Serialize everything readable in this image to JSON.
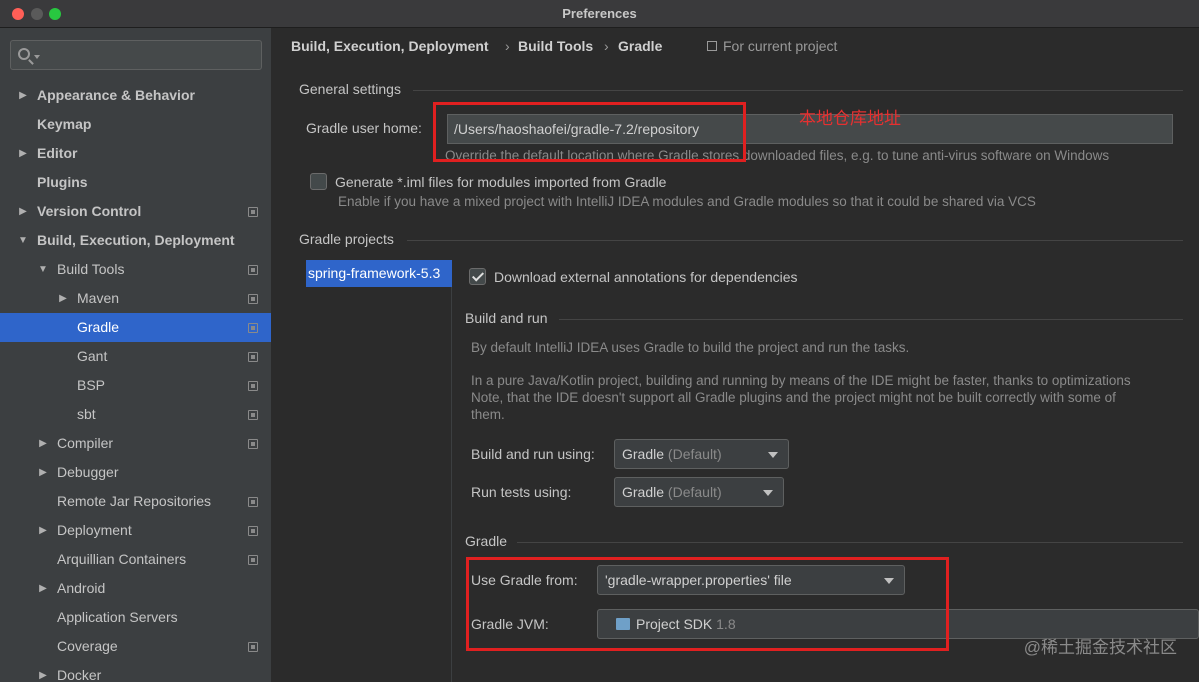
{
  "window": {
    "title": "Preferences"
  },
  "search": {
    "placeholder": ""
  },
  "sidebar": {
    "items": [
      {
        "label": "Appearance & Behavior",
        "bold": true,
        "arrow": "right",
        "level": 0,
        "project_icon": false
      },
      {
        "label": "Keymap",
        "bold": true,
        "arrow": "",
        "level": 0,
        "project_icon": false
      },
      {
        "label": "Editor",
        "bold": true,
        "arrow": "right",
        "level": 0,
        "project_icon": false
      },
      {
        "label": "Plugins",
        "bold": true,
        "arrow": "",
        "level": 0,
        "project_icon": false
      },
      {
        "label": "Version Control",
        "bold": true,
        "arrow": "right",
        "level": 0,
        "project_icon": true
      },
      {
        "label": "Build, Execution, Deployment",
        "bold": true,
        "arrow": "down",
        "level": 0,
        "project_icon": false
      },
      {
        "label": "Build Tools",
        "bold": false,
        "arrow": "down",
        "level": 1,
        "project_icon": true
      },
      {
        "label": "Maven",
        "bold": false,
        "arrow": "right",
        "level": 2,
        "project_icon": true
      },
      {
        "label": "Gradle",
        "bold": false,
        "arrow": "",
        "level": 2,
        "project_icon": true,
        "selected": true
      },
      {
        "label": "Gant",
        "bold": false,
        "arrow": "",
        "level": 2,
        "project_icon": true
      },
      {
        "label": "BSP",
        "bold": false,
        "arrow": "",
        "level": 2,
        "project_icon": true
      },
      {
        "label": "sbt",
        "bold": false,
        "arrow": "",
        "level": 2,
        "project_icon": true
      },
      {
        "label": "Compiler",
        "bold": false,
        "arrow": "right",
        "level": 1,
        "project_icon": true
      },
      {
        "label": "Debugger",
        "bold": false,
        "arrow": "right",
        "level": 1,
        "project_icon": false
      },
      {
        "label": "Remote Jar Repositories",
        "bold": false,
        "arrow": "",
        "level": 1,
        "project_icon": true
      },
      {
        "label": "Deployment",
        "bold": false,
        "arrow": "right",
        "level": 1,
        "project_icon": true
      },
      {
        "label": "Arquillian Containers",
        "bold": false,
        "arrow": "",
        "level": 1,
        "project_icon": true
      },
      {
        "label": "Android",
        "bold": false,
        "arrow": "right",
        "level": 1,
        "project_icon": false
      },
      {
        "label": "Application Servers",
        "bold": false,
        "arrow": "",
        "level": 1,
        "project_icon": false
      },
      {
        "label": "Coverage",
        "bold": false,
        "arrow": "",
        "level": 1,
        "project_icon": true
      },
      {
        "label": "Docker",
        "bold": false,
        "arrow": "right",
        "level": 1,
        "project_icon": false
      }
    ]
  },
  "breadcrumb": {
    "items": [
      "Build, Execution, Deployment",
      "Build Tools",
      "Gradle"
    ],
    "scope": "For current project"
  },
  "general": {
    "section": "General settings",
    "user_home_label": "Gradle user home:",
    "user_home_value": "/Users/haoshaofei/gradle-7.2/repository",
    "user_home_hint": "Override the default location where Gradle stores downloaded files, e.g. to tune anti-virus software on Windows",
    "annotation": "本地仓库地址",
    "iml_label": "Generate *.iml files for modules imported from Gradle",
    "iml_hint": "Enable if you have a mixed project with IntelliJ IDEA modules and Gradle modules so that it could be shared via VCS"
  },
  "projects": {
    "section": "Gradle projects",
    "list": [
      "spring-framework-5.3"
    ],
    "download_annotations_label": "Download external annotations for dependencies"
  },
  "build_run": {
    "section": "Build and run",
    "desc1": "By default IntelliJ IDEA uses Gradle to build the project and run the tasks.",
    "desc2_line1": "In a pure Java/Kotlin project, building and running by means of the IDE might be faster, thanks to optimizations",
    "desc2_line2": "Note, that the IDE doesn't support all Gradle plugins and the project might not be built correctly with some of",
    "desc2_line3": "them.",
    "build_using_label": "Build and run using:",
    "build_using_value": "Gradle",
    "build_using_default": "(Default)",
    "tests_using_label": "Run tests using:",
    "tests_using_value": "Gradle",
    "tests_using_default": "(Default)"
  },
  "gradle": {
    "section": "Gradle",
    "use_from_label": "Use Gradle from:",
    "use_from_value": "'gradle-wrapper.properties' file",
    "jvm_label": "Gradle JVM:",
    "jvm_value": "Project SDK",
    "jvm_version": "1.8"
  },
  "watermark": "@稀土掘金技术社区",
  "colors": {
    "selection": "#2f65ca",
    "annotation_red": "#e02020"
  }
}
